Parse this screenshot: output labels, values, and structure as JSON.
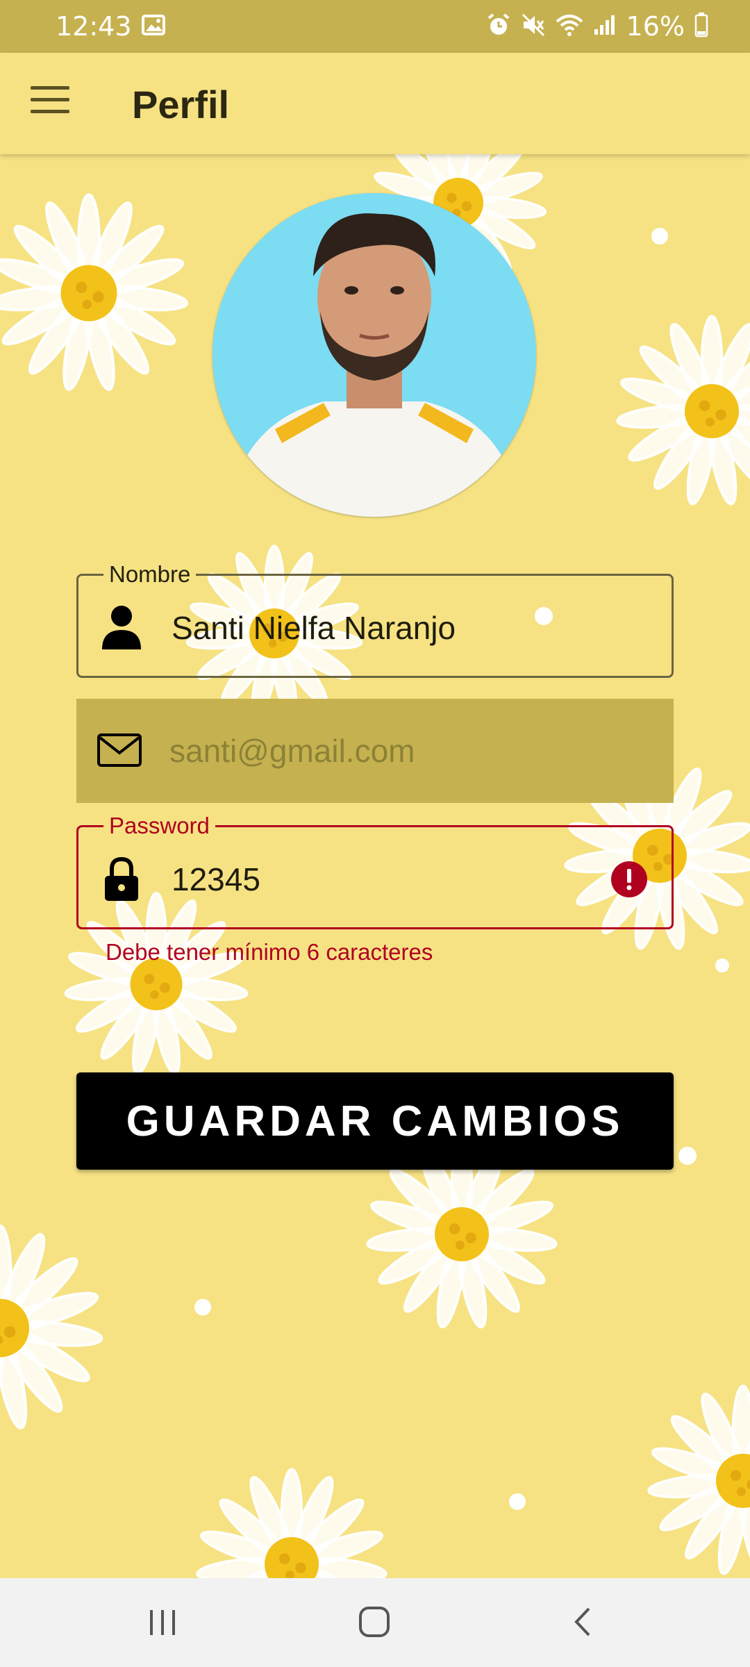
{
  "status_bar": {
    "time": "12:43",
    "battery": "16%",
    "icons": [
      "image-icon",
      "alarm-icon",
      "mute-icon",
      "wifi-icon",
      "signal-icon",
      "battery-icon"
    ]
  },
  "app_bar": {
    "title": "Perfil",
    "menu_icon": "hamburger-menu-icon"
  },
  "profile": {
    "avatar": "profile-photo"
  },
  "form": {
    "name": {
      "label": "Nombre",
      "value": "Santi Nielfa Naranjo",
      "icon": "person-icon"
    },
    "email": {
      "value": "santi@gmail.com",
      "icon": "mail-icon",
      "disabled": true
    },
    "password": {
      "label": "Password",
      "value": "12345",
      "icon": "lock-icon",
      "error_icon": "error-icon",
      "helper": "Debe tener mínimo 6 caracteres"
    },
    "save_label": "GUARDAR CAMBIOS"
  },
  "nav_bar": {
    "items": [
      "recents-icon",
      "home-icon",
      "back-icon"
    ]
  },
  "colors": {
    "background": "#f6e283",
    "status_bar": "#c6b150",
    "error": "#b00020",
    "button": "#000000"
  }
}
